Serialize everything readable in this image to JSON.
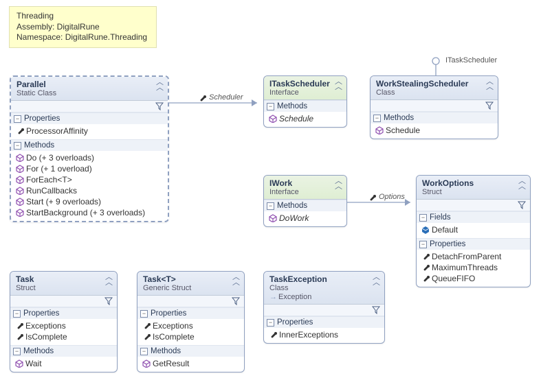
{
  "note": {
    "line1": "Threading",
    "line2": "Assembly: DigitalRune",
    "line3": "Namespace: DigitalRune.Threading"
  },
  "relations": {
    "scheduler_label": "Scheduler",
    "options_label": "Options",
    "itaskscheduler_lollipop": "ITaskScheduler"
  },
  "parallel": {
    "title": "Parallel",
    "sub": "Static Class",
    "sec_props": "Properties",
    "sec_methods": "Methods",
    "props": {
      "p0": "ProcessorAffinity"
    },
    "methods": {
      "m0": "Do (+ 3 overloads)",
      "m1": "For (+ 1 overload)",
      "m2": "ForEach<T>",
      "m3": "RunCallbacks",
      "m4": "Start (+ 9 overloads)",
      "m5": "StartBackground (+ 3 overloads)"
    }
  },
  "itaskscheduler": {
    "title": "ITaskScheduler",
    "sub": "Interface",
    "sec_methods": "Methods",
    "methods": {
      "m0": "Schedule"
    }
  },
  "workstealing": {
    "title": "WorkStealingScheduler",
    "sub": "Class",
    "sec_methods": "Methods",
    "methods": {
      "m0": "Schedule"
    }
  },
  "iwork": {
    "title": "IWork",
    "sub": "Interface",
    "sec_methods": "Methods",
    "methods": {
      "m0": "DoWork"
    }
  },
  "workoptions": {
    "title": "WorkOptions",
    "sub": "Struct",
    "sec_fields": "Fields",
    "sec_props": "Properties",
    "fields": {
      "f0": "Default"
    },
    "props": {
      "p0": "DetachFromParent",
      "p1": "MaximumThreads",
      "p2": "QueueFIFO"
    }
  },
  "task": {
    "title": "Task",
    "sub": "Struct",
    "sec_props": "Properties",
    "sec_methods": "Methods",
    "props": {
      "p0": "Exceptions",
      "p1": "IsComplete"
    },
    "methods": {
      "m0": "Wait"
    }
  },
  "taskT": {
    "title": "Task<T>",
    "sub": "Generic Struct",
    "sec_props": "Properties",
    "sec_methods": "Methods",
    "props": {
      "p0": "Exceptions",
      "p1": "IsComplete"
    },
    "methods": {
      "m0": "GetResult"
    }
  },
  "taskexception": {
    "title": "TaskException",
    "sub": "Class",
    "base": "Exception",
    "sec_props": "Properties",
    "props": {
      "p0": "InnerExceptions"
    }
  }
}
